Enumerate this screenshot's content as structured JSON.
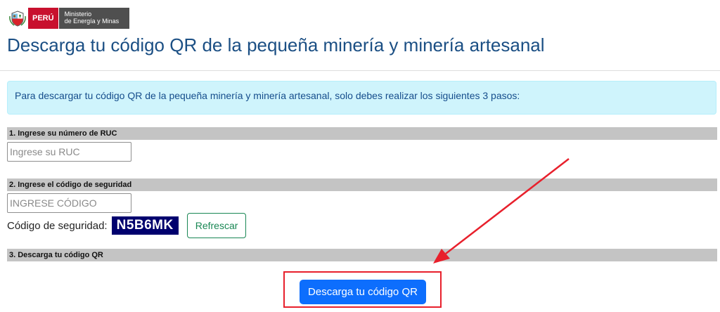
{
  "header": {
    "logo_country": "PERÚ",
    "logo_ministry_line1": "Ministerio",
    "logo_ministry_line2": "de Energía y Minas",
    "title": "Descarga tu código QR de la pequeña minería y minería artesanal"
  },
  "alert": {
    "text": "Para descargar tu código QR de la pequeña minería y minería artesanal, solo debes realizar los siguientes 3 pasos:"
  },
  "step1": {
    "title": "1. Ingrese su número de RUC",
    "placeholder": "Ingrese su RUC",
    "value": ""
  },
  "step2": {
    "title": "2. Ingrese el código de seguridad",
    "placeholder": "INGRESE CÓDIGO",
    "value": "",
    "captcha_label": "Código de seguridad:",
    "captcha_code": "N5B6MK",
    "refresh_label": "Refrescar"
  },
  "step3": {
    "title": "3. Descarga tu código QR",
    "download_label": "Descarga tu código QR"
  },
  "colors": {
    "title": "#1b4f84",
    "alert_bg": "#cff4fc",
    "step_bar": "#c4c4c4",
    "captcha_bg": "#00006e",
    "primary": "#0d6efd",
    "success": "#198754",
    "annotation": "#e8202c"
  },
  "icons": {
    "crest": "peru-coat-of-arms-icon",
    "annotation_arrow": "red-arrow-icon"
  }
}
